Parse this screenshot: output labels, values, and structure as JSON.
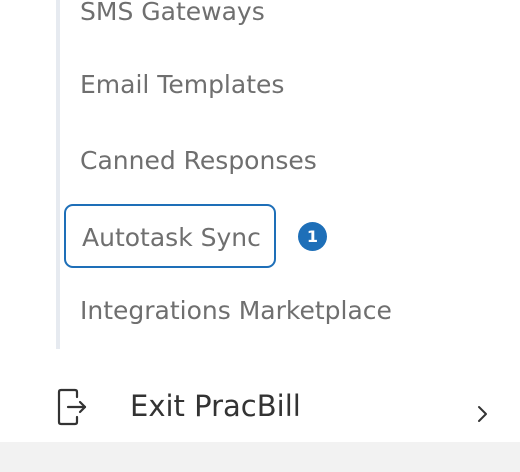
{
  "submenu": {
    "items": [
      {
        "label": "SMS Gateways"
      },
      {
        "label": "Email Templates"
      },
      {
        "label": "Canned Responses"
      },
      {
        "label": "Autotask Sync",
        "badge": "1",
        "selected": true
      },
      {
        "label": "Integrations Marketplace"
      }
    ]
  },
  "exit": {
    "label": "Exit PracBill",
    "icon": "logout-icon",
    "chevron_icon": "chevron-right-icon"
  },
  "colors": {
    "accent": "#1e6fb8",
    "item_text": "#6f6f6f",
    "exit_text": "#333333",
    "rail": "#e6eaf0",
    "bottom_band": "#f2f2f2"
  }
}
